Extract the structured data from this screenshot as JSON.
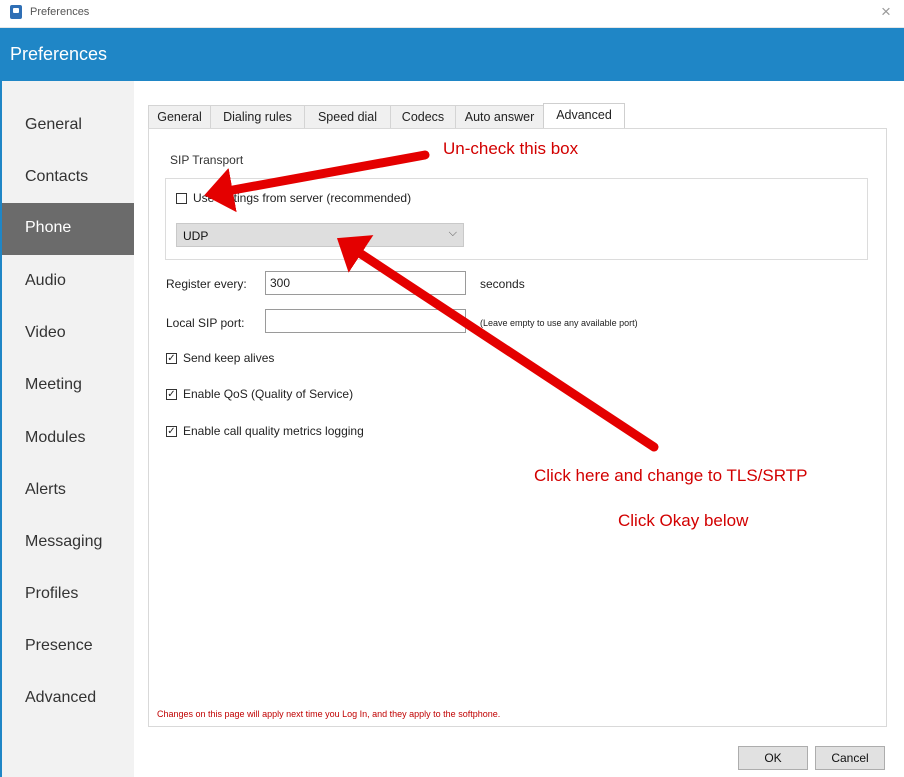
{
  "window": {
    "title": "Preferences",
    "close_glyph": "×"
  },
  "header": {
    "title": "Preferences"
  },
  "sidebar": {
    "items": [
      {
        "label": "General"
      },
      {
        "label": "Contacts"
      },
      {
        "label": "Phone",
        "active": true
      },
      {
        "label": "Audio"
      },
      {
        "label": "Video"
      },
      {
        "label": "Meeting"
      },
      {
        "label": "Modules"
      },
      {
        "label": "Alerts"
      },
      {
        "label": "Messaging"
      },
      {
        "label": "Profiles"
      },
      {
        "label": "Presence"
      },
      {
        "label": "Advanced"
      }
    ]
  },
  "tabs": [
    {
      "label": "General"
    },
    {
      "label": "Dialing rules"
    },
    {
      "label": "Speed dial"
    },
    {
      "label": "Codecs"
    },
    {
      "label": "Auto answer"
    },
    {
      "label": "Advanced",
      "active": true
    }
  ],
  "sip": {
    "heading": "SIP Transport",
    "use_server_settings_label": "Use settings from server (recommended)",
    "use_server_settings_checked": false,
    "transport_value": "UDP",
    "chevron": "⌵"
  },
  "register": {
    "label": "Register every:",
    "value": "300",
    "unit": "seconds"
  },
  "local_port": {
    "label": "Local SIP port:",
    "value": "",
    "hint": "(Leave empty to use any available port)"
  },
  "checks": [
    {
      "label": "Send keep alives",
      "checked": true
    },
    {
      "label": "Enable QoS (Quality of Service)",
      "checked": true
    },
    {
      "label": "Enable call quality metrics logging",
      "checked": true
    }
  ],
  "note": "Changes on this page will apply next time you Log In, and they apply to the softphone.",
  "annotations": {
    "uncheck": "Un-check this box",
    "change": "Click here and change to TLS/SRTP",
    "okay": "Click Okay below"
  },
  "buttons": {
    "ok": "OK",
    "cancel": "Cancel"
  },
  "colors": {
    "header": "#1f86c6",
    "sidebar_active": "#6b6b6b",
    "annotation": "#d20000"
  }
}
